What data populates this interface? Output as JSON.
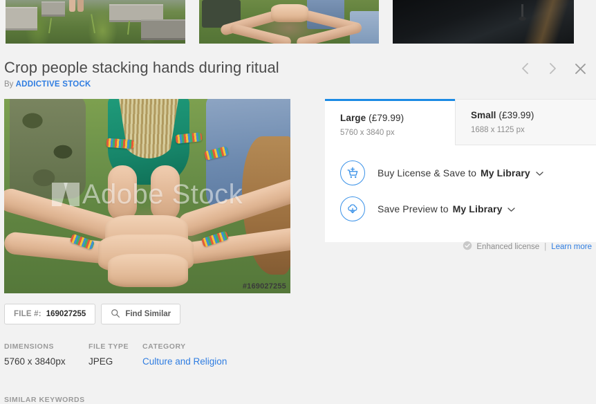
{
  "thumbnails": [
    {
      "name": "garden-plot-thumbnail",
      "alt": "garden beds with green plants"
    },
    {
      "name": "stacking-hands-thumbnail",
      "alt": "people stacking hands on grass"
    },
    {
      "name": "dark-road-thumbnail",
      "alt": "dark asphalt road at night"
    }
  ],
  "header": {
    "title": "Crop people stacking hands during ritual",
    "by_prefix": "By",
    "author": "ADDICTIVE STOCK",
    "nav": {
      "prev_icon": "chevron-left-icon",
      "next_icon": "chevron-right-icon",
      "close_icon": "close-icon"
    }
  },
  "preview": {
    "watermark": "Adobe Stock",
    "file_badge": "#169027255"
  },
  "license_panel": {
    "tabs": [
      {
        "id": "large",
        "size_label": "Large",
        "price": "(£79.99)",
        "dimensions": "5760 x 3840 px",
        "active": true
      },
      {
        "id": "small",
        "size_label": "Small",
        "price": "(£39.99)",
        "dimensions": "1688 x 1125 px",
        "active": false
      }
    ],
    "actions": [
      {
        "id": "buy-license",
        "icon": "cart-add-icon",
        "label": "Buy License & Save to",
        "target": "My Library",
        "chevron": "chevron-down-icon"
      },
      {
        "id": "save-preview",
        "icon": "cloud-download-icon",
        "label": "Save Preview to",
        "target": "My Library",
        "chevron": "chevron-down-icon"
      }
    ],
    "enhanced_license": {
      "icon": "check-circle-icon",
      "label": "Enhanced license",
      "separator": "|",
      "link": "Learn more"
    }
  },
  "toolbar": {
    "file_number_label": "FILE #:",
    "file_number_value": "169027255",
    "find_similar_icon": "search-icon",
    "find_similar_label": "Find Similar"
  },
  "metadata": [
    {
      "heading": "DIMENSIONS",
      "value": "5760 x 3840px",
      "is_link": false
    },
    {
      "heading": "FILE TYPE",
      "value": "JPEG",
      "is_link": false
    },
    {
      "heading": "CATEGORY",
      "value": "Culture and Religion",
      "is_link": true
    }
  ],
  "similar_keywords_heading": "SIMILAR KEYWORDS",
  "colors": {
    "page_bg": "#f2f2f2",
    "accent_blue": "#1b8ae4",
    "link_blue": "#2f7de1",
    "panel_white": "#ffffff",
    "tab_inactive_bg": "#f7f7f7",
    "muted_text": "#8d8d8d"
  }
}
